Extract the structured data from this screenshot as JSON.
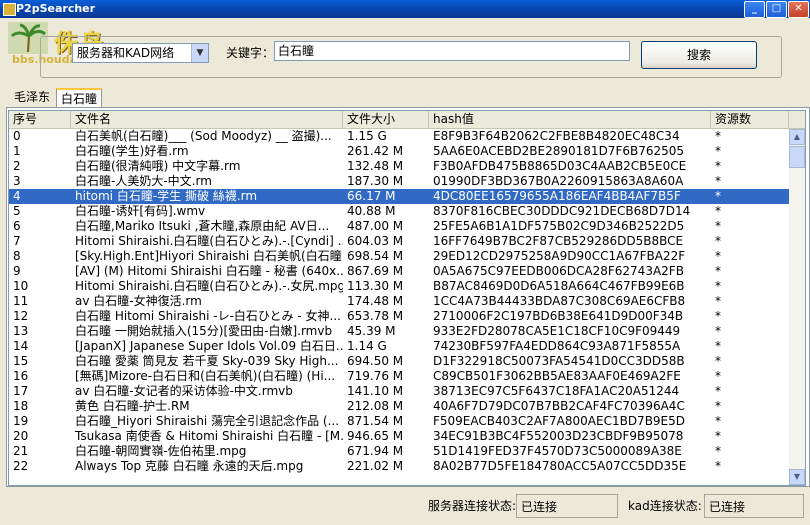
{
  "window": {
    "title": "P2pSearcher",
    "minimize": "_",
    "maximize": "□",
    "close": "✕"
  },
  "logo": {
    "text": "侏岛",
    "url": "bbs.houdao.com"
  },
  "search": {
    "network_select": "服务器和KAD网络",
    "keyword_label": "关键字：",
    "keyword_value": "白石瞳",
    "search_button": "搜索"
  },
  "tabs": [
    {
      "label": "毛泽东"
    },
    {
      "label": "白石瞳"
    }
  ],
  "table": {
    "headers": [
      "序号",
      "文件名",
      "文件大小",
      "hash值",
      "资源数"
    ],
    "selected_index": 4,
    "rows": [
      [
        "0",
        "白石美帆(白石瞳)___ (Sod Moodyz) __ 盗撮)...",
        "1.15 G",
        "E8F9B3F64B2062C2FBE8B4820EC48C34",
        "*"
      ],
      [
        "1",
        "白石瞳(学生)好看.rm",
        "261.42 M",
        "5AA6E0ACEBD2BE2890181D7F6B762505",
        "*"
      ],
      [
        "2",
        "白石瞳(很清純哦) 中文字幕.rm",
        "132.48 M",
        "F3B0AFDB475B8865D03C4AAB2CB5E0CE",
        "*"
      ],
      [
        "3",
        "白石瞳-人美奶大-中文.rm",
        "187.30 M",
        "01990DF3BD367B0A2260915863A8A60A",
        "*"
      ],
      [
        "4",
        "hitomi 白石瞳-学生 撕破 絲襪.rm",
        "66.17 M",
        "4DC80EE16579655A186EAF4BB4AF7B5F",
        "*"
      ],
      [
        "5",
        "白石瞳-诱奸[有码].wmv",
        "40.88 M",
        "8370F816CBEC30DDDC921DECB68D7D14",
        "*"
      ],
      [
        "6",
        "白石瞳,Mariko Itsuki ,蒼木瞳,森原由紀 AV日...",
        "487.00 M",
        "25FE5A6B1A1DF575B02C9D346B2522D5",
        "*"
      ],
      [
        "7",
        "Hitomi Shiraishi.白石瞳(白石ひとみ).-.[Cyndi] ...",
        "604.03 M",
        "16FF7649B7BC2F87CB529286DD5B8BCE",
        "*"
      ],
      [
        "8",
        "[Sky.High.Ent]Hiyori Shiraishi 白石美帆(白石瞳)...",
        "698.54 M",
        "29ED12CD2975258A9D90CC1A67FBA22F",
        "*"
      ],
      [
        "9",
        "[AV] (M) Hitomi Shiraishi 白石瞳 - 秘書 (640x...",
        "867.69 M",
        "0A5A675C97EEDB006DCA28F62743A2FB",
        "*"
      ],
      [
        "10",
        "Hitomi Shiraishi.白石瞳(白石ひとみ).-.女尻.mpg",
        "113.30 M",
        "B87AC8469D0D6A518A664C467FB99E6B",
        "*"
      ],
      [
        "11",
        "av 白石瞳-女神復活.rm",
        "174.48 M",
        "1CC4A73B44433BDA87C308C69AE6CFB8",
        "*"
      ],
      [
        "12",
        "白石瞳 Hitomi Shiraishi -レ-白石ひとみ - 女神...",
        "653.78 M",
        "2710006F2C197BD6B38E641D9D00F34B",
        "*"
      ],
      [
        "13",
        "白石瞳 一開始就插入(15分)[愛田由-白嫩].rmvb",
        "45.39 M",
        "933E2FD28078CA5E1C18CF10C9F09449",
        "*"
      ],
      [
        "14",
        "[JapanX] Japanese Super Idols Vol.09 白石日...",
        "1.14 G",
        "74230BF597FA4EDD864C93A871F5855A",
        "*"
      ],
      [
        "15",
        "白石瞳 愛薬 筒見友 若千夏 Sky-039 Sky High...",
        "694.50 M",
        "D1F322918C50073FA54541D0CC3DD58B",
        "*"
      ],
      [
        "16",
        "[無碼]Mizore-白石日和(白石美帆)(白石瞳) (Hi...",
        "719.76 M",
        "C89CB501F3062BB5AE83AAF0E469A2FE",
        "*"
      ],
      [
        "17",
        "av 白石瞳-女记者的采访体验-中文.rmvb",
        "141.10 M",
        "38713EC97C5F6437C18FA1AC20A51244",
        "*"
      ],
      [
        "18",
        "黄色 白石瞳-护士.RM",
        "212.08 M",
        "40A6F7D79DC07B7BB2CAF4FC70396A4C",
        "*"
      ],
      [
        "19",
        "白石瞳_Hiyori Shiraishi 蕩完全引退記念作品 (...",
        "871.54 M",
        "F509EACB403C2AF7A800AEC1BD7B9E5D",
        "*"
      ],
      [
        "20",
        "Tsukasa 南使香 & Hitomi Shiraishi 白石瞳 - [M...",
        "946.65 M",
        "34EC91B3BC4F552003D23CBDF9B95078",
        "*"
      ],
      [
        "21",
        "白石瞳-朝岡實嶺-佐伯祐里.mpg",
        "671.94 M",
        "51D1419FED37F4570D73C5000089A38E",
        "*"
      ],
      [
        "22",
        "Always Top 克藤 白石瞳 永遠的天后.mpg",
        "221.02 M",
        "8A02B77D5FE184780ACC5A07CC5DD35E",
        "*"
      ]
    ]
  },
  "status": {
    "server_label": "服务器连接状态:",
    "server_value": "已连接",
    "kad_label": "kad连接状态:",
    "kad_value": "已连接"
  }
}
